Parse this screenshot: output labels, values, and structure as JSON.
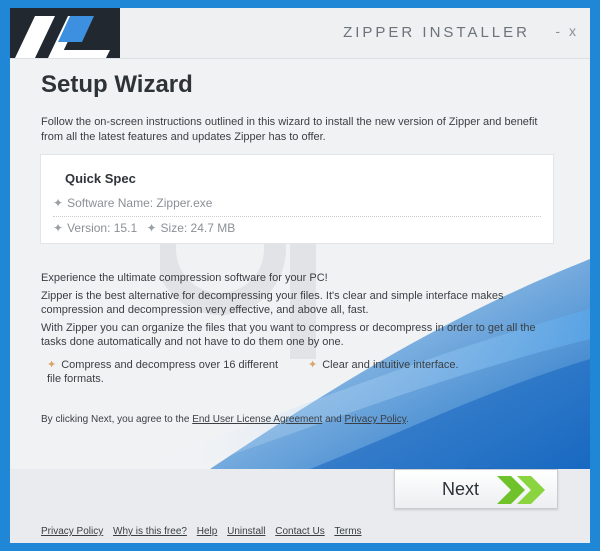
{
  "window": {
    "title": "ZIPPER INSTALLER",
    "minimize": "-",
    "close": "x"
  },
  "main": {
    "heading": "Setup Wizard",
    "intro": "Follow the on-screen instructions outlined in this wizard to install the new version of Zipper and benefit from all the latest features and updates Zipper has to offer."
  },
  "spec": {
    "title": "Quick Spec",
    "software_name": "Software Name: Zipper.exe",
    "version": "Version: 15.1",
    "size": "Size: 24.7 MB"
  },
  "body": {
    "p1": "Experience the ultimate compression software for your PC!",
    "p2": "Zipper is the best alternative for decompressing your files. It's clear and simple interface makes compression and decompression very effective, and above all, fast.",
    "p3": "With Zipper you can organize the files that you want to compress or decompress in order to get all the tasks done automatically and not have to do them one by one.",
    "feature1": "Compress and decompress over 16 different file formats.",
    "feature2": "Clear and intuitive interface."
  },
  "agreement": {
    "prefix": "By clicking Next, you agree to the",
    "eula": "End User License Agreement",
    "and": "and",
    "privacy": "Privacy Policy",
    "suffix": "."
  },
  "next_button": {
    "label": "Next"
  },
  "footer": {
    "links": [
      "Privacy Policy",
      "Why is this free?",
      "Help",
      "Uninstall",
      "Contact Us",
      "Terms"
    ]
  },
  "colors": {
    "border_blue": "#1f87d6",
    "accent_green": "#6fc22a",
    "text": "#3a3f44"
  }
}
